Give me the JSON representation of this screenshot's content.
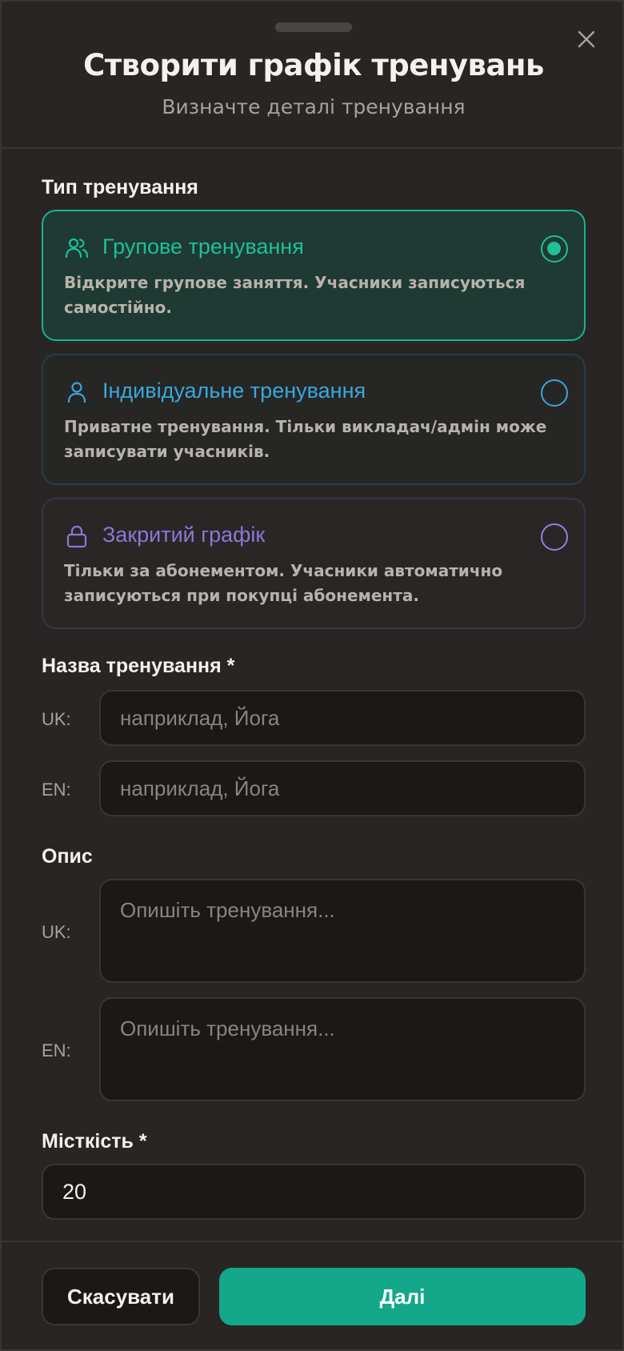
{
  "header": {
    "title": "Створити графік тренувань",
    "subtitle": "Визначте деталі тренування",
    "close_icon": "close-icon"
  },
  "training_type": {
    "label": "Тип тренування",
    "options": [
      {
        "title": "Групове тренування",
        "description": "Відкрите групове заняття. Учасники записуються самостійно.",
        "icon": "users-icon",
        "selected": true,
        "color": "#1fbf98"
      },
      {
        "title": "Індивідуальне тренування",
        "description": "Приватне тренування. Тільки викладач/адмін може записувати учасників.",
        "icon": "user-icon",
        "selected": false,
        "color": "#3aa7dc"
      },
      {
        "title": "Закритий графік",
        "description": "Тільки за абонементом. Учасники автоматично записуються при покупці абонемента.",
        "icon": "lock-icon",
        "selected": false,
        "color": "#8779d6"
      }
    ]
  },
  "name": {
    "label": "Назва тренування *",
    "uk": {
      "lang": "UK:",
      "placeholder": "наприклад, Йога"
    },
    "en": {
      "lang": "EN:",
      "placeholder": "наприклад, Йога"
    }
  },
  "description": {
    "label": "Опис",
    "uk": {
      "lang": "UK:",
      "placeholder": "Опишіть тренування..."
    },
    "en": {
      "lang": "EN:",
      "placeholder": "Опишіть тренування..."
    }
  },
  "capacity": {
    "label": "Місткість *",
    "value": "20"
  },
  "footer": {
    "cancel_label": "Скасувати",
    "next_label": "Далі"
  },
  "colors": {
    "accent": "#14a88a",
    "background": "#292524"
  }
}
